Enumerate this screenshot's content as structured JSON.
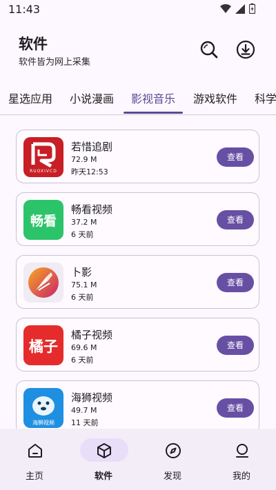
{
  "status": {
    "time": "11:43"
  },
  "header": {
    "title": "软件",
    "subtitle": "软件皆为网上采集"
  },
  "tabs": [
    {
      "label": "星选应用"
    },
    {
      "label": "小说漫画"
    },
    {
      "label": "影视音乐",
      "active": true
    },
    {
      "label": "游戏软件"
    },
    {
      "label": "科学"
    }
  ],
  "apps": [
    {
      "name": "若惜追剧",
      "size": "72.9 M",
      "time": "昨天12:53",
      "button": "查看",
      "icon_text": "RUOXIVCD",
      "icon_color": "#c81e25"
    },
    {
      "name": "畅看视频",
      "size": "37.2 M",
      "time": "6 天前",
      "button": "查看",
      "icon_text": "畅看",
      "icon_color": "#2cc46a"
    },
    {
      "name": "卜影",
      "size": "75.1 M",
      "time": "6 天前",
      "button": "查看",
      "icon_text": "",
      "icon_color": "#d8345f"
    },
    {
      "name": "橘子视频",
      "size": "69.6 M",
      "time": "6 天前",
      "button": "查看",
      "icon_text": "橘子",
      "icon_color": "#e52b2b"
    },
    {
      "name": "海狮视频",
      "size": "49.7 M",
      "time": "11 天前",
      "button": "查看",
      "icon_text": "海狮视频",
      "icon_color": "#1e8fe1"
    }
  ],
  "nav": [
    {
      "label": "主页",
      "icon": "home-icon"
    },
    {
      "label": "软件",
      "icon": "cube-icon",
      "active": true
    },
    {
      "label": "发现",
      "icon": "compass-icon"
    },
    {
      "label": "我的",
      "icon": "profile-icon"
    }
  ],
  "colors": {
    "accent": "#6750a4",
    "tab_active": "#5a4a92",
    "nav_bg": "#f3edf7",
    "nav_pill": "#e8def8"
  }
}
